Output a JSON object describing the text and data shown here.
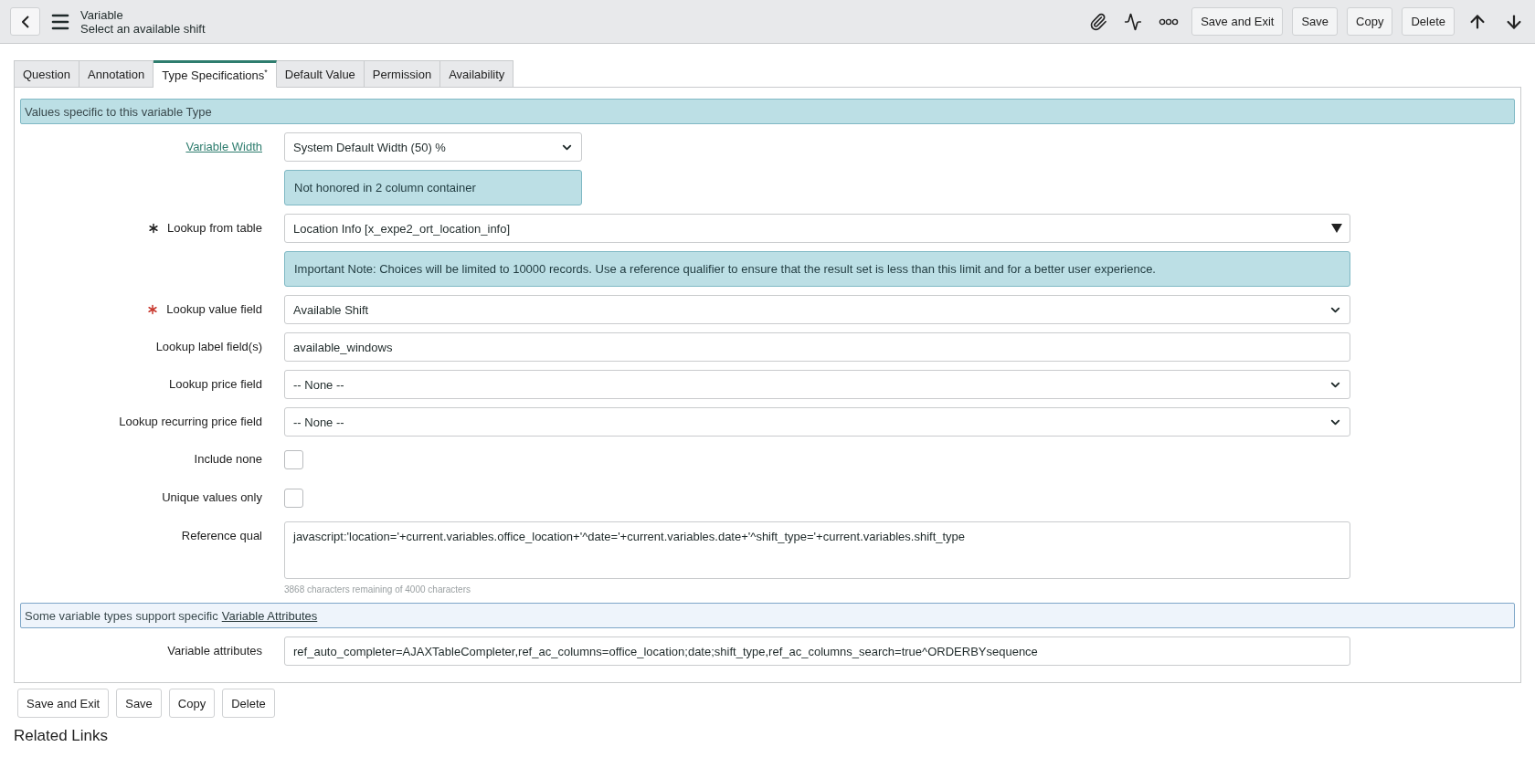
{
  "header": {
    "title": "Variable",
    "subtitle": "Select an available shift",
    "buttons": [
      "Save and Exit",
      "Save",
      "Copy",
      "Delete"
    ]
  },
  "tabs": [
    {
      "label": "Question",
      "selected": false
    },
    {
      "label": "Annotation",
      "selected": false
    },
    {
      "label": "Type Specifications",
      "suffix": "*",
      "selected": true
    },
    {
      "label": "Default Value",
      "selected": false
    },
    {
      "label": "Permission",
      "selected": false
    },
    {
      "label": "Availability",
      "selected": false
    }
  ],
  "section_banner": "Values specific to this variable Type",
  "fields": [
    {
      "kind": "select",
      "label": "Variable Width",
      "label_link": true,
      "value": "System Default Width (50) %",
      "half_width": true
    },
    {
      "kind": "note",
      "text": "Not honored in 2 column container",
      "half_width": true
    },
    {
      "kind": "reference",
      "label": "Lookup from table",
      "mandatory": true,
      "filled": true,
      "value": "Location Info [x_expe2_ort_location_info]"
    },
    {
      "kind": "note",
      "text": "Important Note: Choices will be limited to 10000 records. Use a reference qualifier to ensure that the result set is less than this limit and for a better user experience."
    },
    {
      "kind": "select",
      "label": "Lookup value field",
      "mandatory": true,
      "filled": false,
      "value": "Available Shift"
    },
    {
      "kind": "input",
      "label": "Lookup label field(s)",
      "value": "available_windows"
    },
    {
      "kind": "select",
      "label": "Lookup price field",
      "value": "-- None --"
    },
    {
      "kind": "select",
      "label": "Lookup recurring price field",
      "value": "-- None --"
    },
    {
      "kind": "checkbox",
      "label": "Include none",
      "checked": false
    },
    {
      "kind": "checkbox",
      "label": "Unique values only",
      "checked": false
    },
    {
      "kind": "textarea",
      "label": "Reference qual",
      "value": "javascript:'location='+current.variables.office_location+'^date='+current.variables.date+'^shift_type='+current.variables.shift_type",
      "counter": "3868 characters remaining of 4000 characters"
    },
    {
      "kind": "banner",
      "text": "Some variable types support specific",
      "link": "Variable Attributes"
    },
    {
      "kind": "input",
      "label": "Variable attributes",
      "value": "ref_auto_completer=AJAXTableCompleter,ref_ac_columns=office_location;date;shift_type,ref_ac_columns_search=true^ORDERBYsequence"
    }
  ],
  "footer_buttons": [
    "Save and Exit",
    "Save",
    "Copy",
    "Delete"
  ],
  "related_links": {
    "title": "Related Links"
  }
}
